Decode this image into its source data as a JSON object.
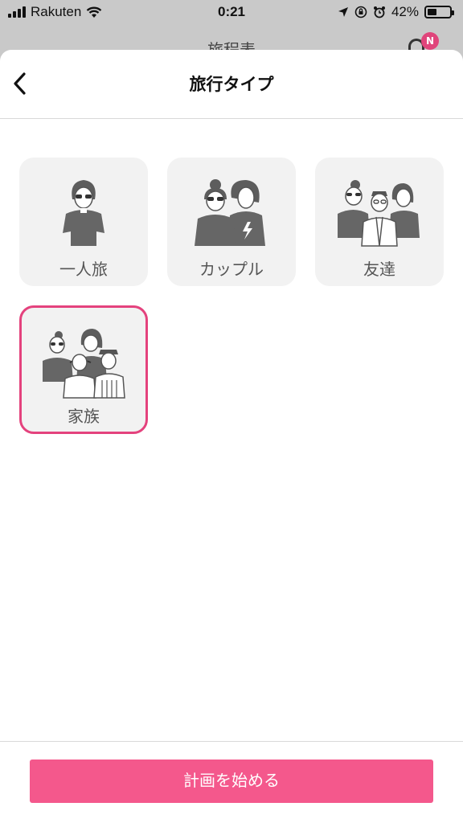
{
  "status_bar": {
    "carrier": "Rakuten",
    "time": "0:21",
    "battery_percent": "42%",
    "battery_level": 0.42,
    "icons": [
      "signal-icon",
      "wifi-icon",
      "location-icon",
      "orientation-lock-icon",
      "alarm-icon",
      "battery-icon"
    ]
  },
  "background": {
    "title": "旅程表",
    "notification_badge": "N"
  },
  "header": {
    "title": "旅行タイプ",
    "back_icon": "chevron-left-icon"
  },
  "trip_types": [
    {
      "label": "一人旅",
      "icon": "solo-traveler-icon",
      "selected": false
    },
    {
      "label": "カップル",
      "icon": "couple-icon",
      "selected": false
    },
    {
      "label": "友達",
      "icon": "friends-icon",
      "selected": false
    },
    {
      "label": "家族",
      "icon": "family-icon",
      "selected": true
    }
  ],
  "footer": {
    "start_label": "計画を始める"
  },
  "colors": {
    "accent": "#e4427d",
    "button": "#f4588c",
    "card_bg": "#f2f2f2"
  }
}
